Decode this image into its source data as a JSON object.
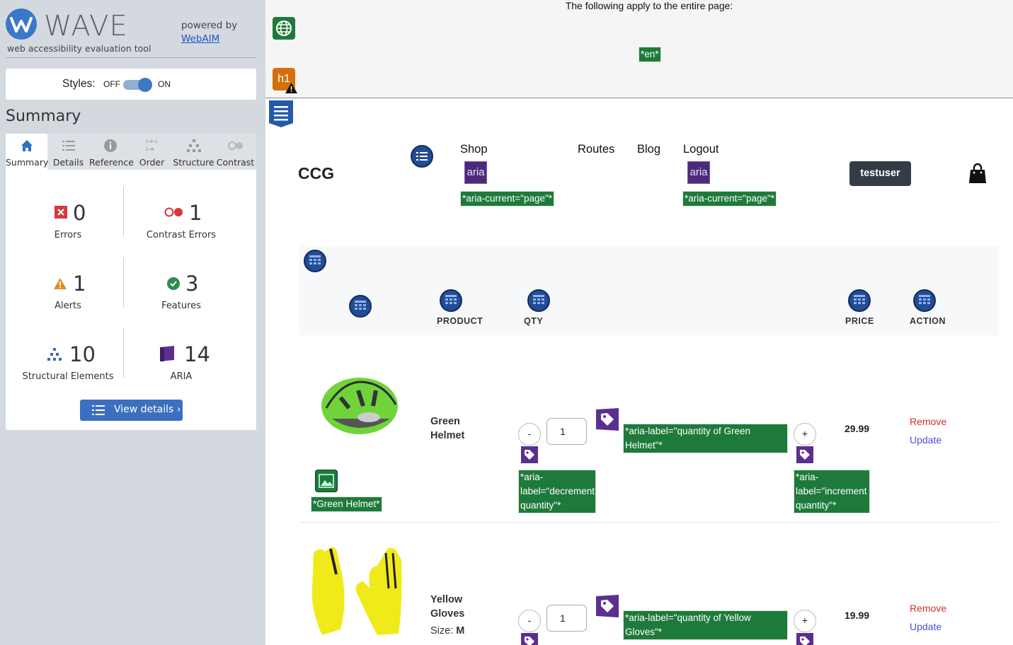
{
  "wave": {
    "name": "WAVE",
    "tagline": "web accessibility evaluation tool",
    "powered_by": "powered by",
    "webaim": "WebAIM",
    "styles_label": "Styles:",
    "styles_off": "OFF",
    "styles_on": "ON",
    "summary_title": "Summary",
    "tabs": [
      {
        "label": "Summary",
        "icon": "home-icon"
      },
      {
        "label": "Details",
        "icon": "list-icon"
      },
      {
        "label": "Reference",
        "icon": "info-icon"
      },
      {
        "label": "Order",
        "icon": "order-icon"
      },
      {
        "label": "Structure",
        "icon": "structure-icon"
      },
      {
        "label": "Contrast",
        "icon": "contrast-icon"
      }
    ],
    "stats": {
      "errors": {
        "count": "0",
        "label": "Errors"
      },
      "contrast": {
        "count": "1",
        "label": "Contrast Errors"
      },
      "alerts": {
        "count": "1",
        "label": "Alerts"
      },
      "features": {
        "count": "3",
        "label": "Features"
      },
      "structural": {
        "count": "10",
        "label": "Structural Elements"
      },
      "aria": {
        "count": "14",
        "label": "ARIA"
      }
    },
    "view_details": "View details ›"
  },
  "page": {
    "doc_note": "The following apply to the entire page:",
    "lang_tag": "*en*",
    "h1_badge": "h1",
    "brand": "CCG",
    "nav": {
      "shop": "Shop",
      "routes": "Routes",
      "blog": "Blog",
      "logout": "Logout"
    },
    "aria_badge": "aria",
    "aria_current": "*aria-current=\"page\"*",
    "user_button": "testuser",
    "table_headers": {
      "product": "PRODUCT",
      "qty": "QTY",
      "price": "PRICE",
      "action": "ACTION"
    },
    "decrement_label": "*aria-label=\"decrement quantity\"*",
    "increment_label": "*aria-label=\"increment quantity\"*",
    "minus": "-",
    "plus": "+",
    "remove": "Remove",
    "update": "Update",
    "items": [
      {
        "name": "Green Helmet",
        "alt_tag": "*Green Helmet*",
        "qty": "1",
        "qty_label": "*aria-label=\"quantity of Green Helmet\"*",
        "price": "29.99"
      },
      {
        "name": "Yellow Gloves",
        "size_label": "Size:",
        "size_value": "M",
        "qty": "1",
        "qty_label": "*aria-label=\"quantity of Yellow Gloves\"*",
        "price": "19.99"
      }
    ]
  }
}
